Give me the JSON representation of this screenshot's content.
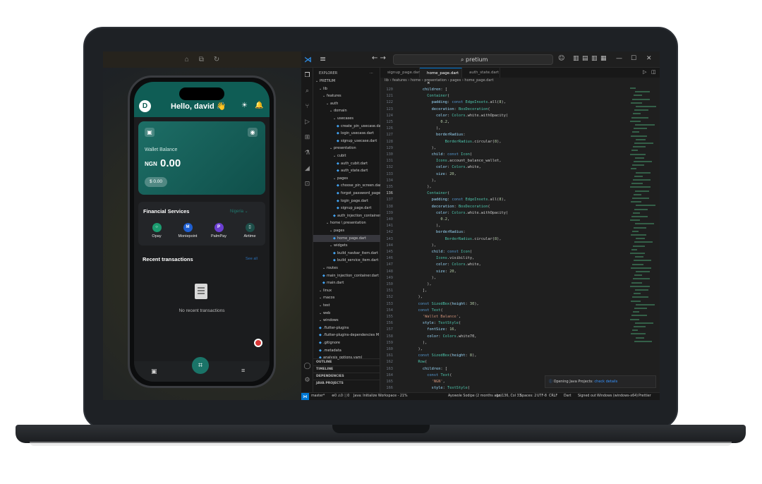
{
  "phone_app": {
    "avatar_initial": "D",
    "greeting": "Hello, david 👋",
    "wallet_label": "Wallet Balance",
    "currency": "NGN",
    "balance": "0.00",
    "usd_pill": "$ 0.00",
    "financial_services_title": "Financial Services",
    "country_selector": "Nigeria ⌄",
    "services": [
      "Opay",
      "Moniepoint",
      "PalmPay",
      "Airtime"
    ],
    "recent_transactions_title": "Recent transactions",
    "see_all": "See all",
    "empty_text": "No recent transactions",
    "colors": {
      "primary": "#0f5d55",
      "card": "#1d6e66",
      "accent": "#1a7468"
    }
  },
  "vscode": {
    "search_text": "⌕ pretium",
    "explorer_title": "EXPLORER",
    "tree": [
      {
        "label": "PRETIUM",
        "indent": 0,
        "kind": "root"
      },
      {
        "label": "lib",
        "indent": 1,
        "kind": "folder"
      },
      {
        "label": "features",
        "indent": 2,
        "kind": "folder"
      },
      {
        "label": "auth",
        "indent": 3,
        "kind": "folder"
      },
      {
        "label": "domain",
        "indent": 4,
        "kind": "folder"
      },
      {
        "label": "usecases",
        "indent": 5,
        "kind": "folder"
      },
      {
        "label": "create_pin_usecase.dart",
        "indent": 6,
        "kind": "file"
      },
      {
        "label": "login_usecase.dart",
        "indent": 6,
        "kind": "file"
      },
      {
        "label": "signup_usecase.dart",
        "indent": 6,
        "kind": "file"
      },
      {
        "label": "presentation",
        "indent": 4,
        "kind": "folder"
      },
      {
        "label": "cubit",
        "indent": 5,
        "kind": "folder"
      },
      {
        "label": "auth_cubit.dart",
        "indent": 6,
        "kind": "file"
      },
      {
        "label": "auth_state.dart",
        "indent": 6,
        "kind": "file"
      },
      {
        "label": "pages",
        "indent": 5,
        "kind": "folder"
      },
      {
        "label": "choose_pin_screen.dart",
        "indent": 6,
        "kind": "file"
      },
      {
        "label": "forgot_password_page.dart",
        "indent": 6,
        "kind": "file"
      },
      {
        "label": "login_page.dart",
        "indent": 6,
        "kind": "file"
      },
      {
        "label": "signup_page.dart",
        "indent": 6,
        "kind": "file"
      },
      {
        "label": "auth_injection_container.dart",
        "indent": 5,
        "kind": "file"
      },
      {
        "label": "home \\ presentation",
        "indent": 3,
        "kind": "folder"
      },
      {
        "label": "pages",
        "indent": 4,
        "kind": "folder"
      },
      {
        "label": "home_page.dart",
        "indent": 5,
        "kind": "file",
        "selected": true
      },
      {
        "label": "widgets",
        "indent": 4,
        "kind": "folder"
      },
      {
        "label": "build_navbar_item.dart",
        "indent": 5,
        "kind": "file"
      },
      {
        "label": "build_service_item.dart",
        "indent": 5,
        "kind": "file"
      },
      {
        "label": "routes",
        "indent": 2,
        "kind": "folder"
      },
      {
        "label": "main_injection_container.dart",
        "indent": 2,
        "kind": "file"
      },
      {
        "label": "main.dart",
        "indent": 2,
        "kind": "file"
      },
      {
        "label": "linux",
        "indent": 1,
        "kind": "folder"
      },
      {
        "label": "macos",
        "indent": 1,
        "kind": "folder"
      },
      {
        "label": "test",
        "indent": 1,
        "kind": "folder"
      },
      {
        "label": "web",
        "indent": 1,
        "kind": "folder"
      },
      {
        "label": "windows",
        "indent": 1,
        "kind": "folder"
      },
      {
        "label": ".flutter-plugins",
        "indent": 1,
        "kind": "file"
      },
      {
        "label": ".flutter-plugins-dependencies  M",
        "indent": 1,
        "kind": "file"
      },
      {
        "label": ".gitignore",
        "indent": 1,
        "kind": "file"
      },
      {
        "label": ".metadata",
        "indent": 1,
        "kind": "file"
      },
      {
        "label": "analysis_options.yaml",
        "indent": 1,
        "kind": "file"
      }
    ],
    "sections": [
      "OUTLINE",
      "TIMELINE",
      "DEPENDENCIES",
      "JAVA PROJECTS"
    ],
    "tabs": [
      "signup_page.dart",
      "home_page.dart  ×",
      "auth_state.dart"
    ],
    "breadcrumb": "lib › features › home › presentation › pages › home_page.dart",
    "line_start": 120,
    "current_line": 136,
    "code_lines": [
      "          children: [",
      "            Container(",
      "              padding: const EdgeInsets.all(8),",
      "              decoration: BoxDecoration(",
      "                color: Colors.white.withOpacity(",
      "                  0.2,",
      "                ),",
      "                borderRadius:",
      "                    BorderRadius.circular(8),",
      "              ),",
      "              child: const Icon(",
      "                Icons.account_balance_wallet,",
      "                color: Colors.white,",
      "                size: 20,",
      "              ),",
      "            ),",
      "            Container(",
      "              padding: const EdgeInsets.all(8),",
      "              decoration: BoxDecoration(",
      "                color: Colors.white.withOpacity(",
      "                  0.2,",
      "                ),",
      "                borderRadius:",
      "                    BorderRadius.circular(8),",
      "              ),",
      "              child: const Icon(",
      "                Icons.visibility,",
      "                color: Colors.white,",
      "                size: 20,",
      "              ),",
      "            ),",
      "          ],",
      "        ),",
      "        const SizedBox(height: 30),",
      "        const Text(",
      "          'Wallet Balance',",
      "          style: TextStyle(",
      "            fontSize: 16,",
      "            color: Colors.white70,",
      "          ),",
      "        ),",
      "        const SizedBox(height: 8),",
      "        Row(",
      "          children: [",
      "            const Text(",
      "              'NGN',",
      "              style: TextStyle("
    ],
    "notification": {
      "text": "Opening Java Projects: ",
      "link": "check details"
    },
    "status": {
      "branch": "master*",
      "problems": "⊗0 ⚠0 ⓘ0",
      "java": "Java: Initialize Workspace - 21%",
      "author": "Ayowole Sodipe (2 months ago)",
      "position": "Ln 136, Col 33",
      "spaces": "Spaces: 2",
      "encoding": "UTF-8",
      "eol": "CRLF",
      "language": "Dart",
      "account": "Signed out",
      "device": "Windows (windows-x64)",
      "formatter": "Prettier"
    }
  }
}
